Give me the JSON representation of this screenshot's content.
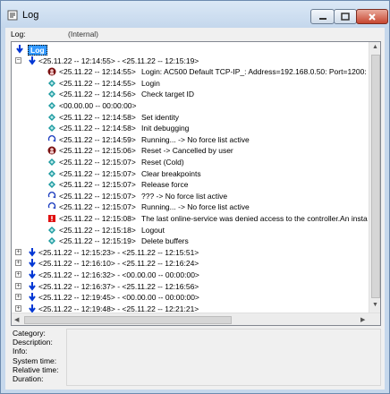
{
  "window": {
    "title": "Log",
    "icon": "log-window-icon"
  },
  "log_selector": {
    "label": "Log:",
    "value": "(Internal)"
  },
  "tree": {
    "root_label": "Log",
    "open_session": {
      "expander": "⊟",
      "label": "<25.11.22 -- 12:14:55> - <25.11.22 -- 12:15:19>",
      "entries": [
        {
          "icon": "error-user-icon",
          "time": "<25.11.22 -- 12:14:55>",
          "message": "Login: AC500 Default TCP-IP_: Address=192.168.0.50: Port=1200:"
        },
        {
          "icon": "info-diamond-icon",
          "time": "<25.11.22 -- 12:14:55>",
          "message": "Login"
        },
        {
          "icon": "info-diamond-icon",
          "time": "<25.11.22 -- 12:14:56>",
          "message": "Check target ID"
        },
        {
          "icon": "info-diamond-icon",
          "time": "<00.00.00 -- 00:00:00>",
          "message": ""
        },
        {
          "icon": "info-diamond-icon",
          "time": "<25.11.22 -- 12:14:58>",
          "message": "Set identity"
        },
        {
          "icon": "info-diamond-icon",
          "time": "<25.11.22 -- 12:14:58>",
          "message": "Init debugging"
        },
        {
          "icon": "running-arrow-icon",
          "time": "<25.11.22 -- 12:14:59>",
          "message": "Running... -> No force list active"
        },
        {
          "icon": "error-user-icon",
          "time": "<25.11.22 -- 12:15:06>",
          "message": "Reset -> Cancelled by user"
        },
        {
          "icon": "info-diamond-icon",
          "time": "<25.11.22 -- 12:15:07>",
          "message": "Reset (Cold)"
        },
        {
          "icon": "info-diamond-icon",
          "time": "<25.11.22 -- 12:15:07>",
          "message": "Clear breakpoints"
        },
        {
          "icon": "info-diamond-icon",
          "time": "<25.11.22 -- 12:15:07>",
          "message": "Release force"
        },
        {
          "icon": "running-arrow-icon",
          "time": "<25.11.22 -- 12:15:07>",
          "message": "??? -> No force list active"
        },
        {
          "icon": "running-arrow-icon",
          "time": "<25.11.22 -- 12:15:07>",
          "message": "Running... -> No force list active"
        },
        {
          "icon": "error-exclamation-icon",
          "time": "<25.11.22 -- 12:15:08>",
          "message": "The last online-service was denied access to the controller.An insta"
        },
        {
          "icon": "info-diamond-icon",
          "time": "<25.11.22 -- 12:15:18>",
          "message": "Logout"
        },
        {
          "icon": "info-diamond-icon",
          "time": "<25.11.22 -- 12:15:19>",
          "message": "Delete buffers"
        }
      ]
    },
    "collapsed_sessions": [
      {
        "expander": "⊞",
        "label": "<25.11.22 -- 12:15:23> - <25.11.22 -- 12:15:51>"
      },
      {
        "expander": "⊞",
        "label": "<25.11.22 -- 12:16:10> - <25.11.22 -- 12:16:24>"
      },
      {
        "expander": "⊞",
        "label": "<25.11.22 -- 12:16:32> - <00.00.00 -- 00:00:00>"
      },
      {
        "expander": "⊞",
        "label": "<25.11.22 -- 12:16:37> - <25.11.22 -- 12:16:56>"
      },
      {
        "expander": "⊞",
        "label": "<25.11.22 -- 12:19:45> - <00.00.00 -- 00:00:00>"
      },
      {
        "expander": "⊞",
        "label": "<25.11.22 -- 12:19:48> - <25.11.22 -- 12:21:21>"
      }
    ]
  },
  "details": {
    "labels": [
      "Category:",
      "Description:",
      "Info:",
      "System time:",
      "Relative time:",
      "Duration:"
    ]
  },
  "colors": {
    "accent": "#3399ff",
    "title_gradient_top": "#dbe8f6",
    "close_button": "#c74630",
    "session_arrow": "#0037d4"
  }
}
